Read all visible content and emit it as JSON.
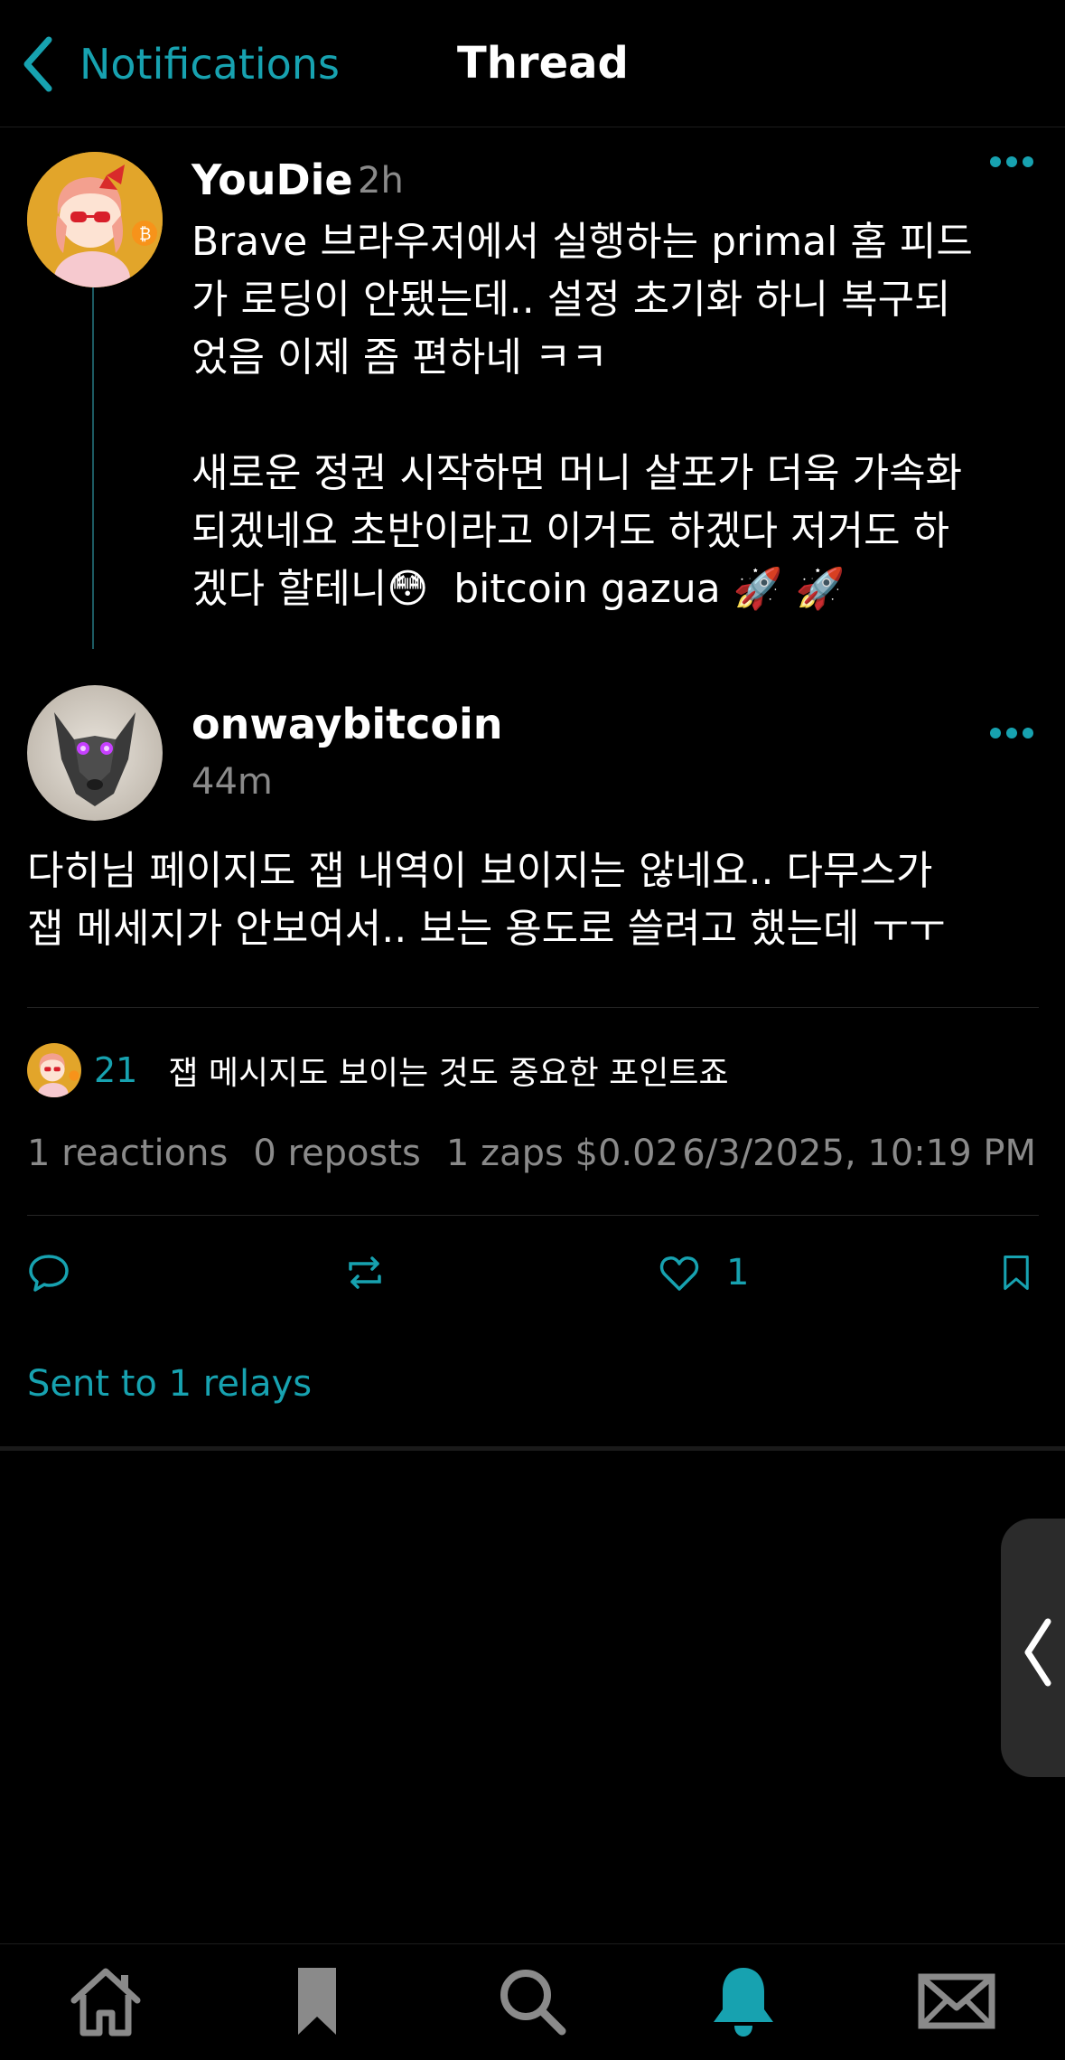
{
  "header": {
    "back_label": "Notifications",
    "title": "Thread"
  },
  "parent_post": {
    "author": "YouDie",
    "time": "2h",
    "text": "Brave 브라우저에서 실행하는 primal 홈 피드\n가 로딩이 안됐는데.. 설정 초기화 하니 복구되\n었음 이제 좀 편하네 ㅋㅋ\n\n새로운 정권 시작하면 머니 살포가 더욱 가속화\n되겠네요 초반이라고 이거도 하겠다 저거도 하\n겠다 할테니😳  bitcoin gazua 🚀 🚀"
  },
  "main_post": {
    "author": "onwaybitcoin",
    "time": "44m",
    "text": "다히님 페이지도 잽 내역이 보이지는 않네요.. 다무스가\n잽 메세지가 안보여서.. 보는 용도로 쓸려고 했는데 ㅜㅜ"
  },
  "top_zap": {
    "amount": "21",
    "comment": "잽 메시지도 보이는 것도 중요한 포인트죠"
  },
  "stats": {
    "reactions": "1 reactions",
    "reposts": "0 reposts",
    "zaps": "1 zaps $0.02",
    "date": "6/3/2025, 10:19 PM"
  },
  "actions": {
    "like_count": "1"
  },
  "relays_text": "Sent to 1 relays",
  "colors": {
    "accent": "#17a2b0",
    "background": "#000000",
    "muted": "#8a8a8a"
  },
  "icons": {
    "back": "chevron-left-icon",
    "more": "more-dots-icon",
    "reply": "reply-bubble-icon",
    "repost": "repost-icon",
    "like": "heart-icon",
    "bookmark": "bookmark-icon",
    "tabs": [
      "home-icon",
      "bookmark-icon",
      "search-icon",
      "bell-icon",
      "mail-icon"
    ]
  }
}
